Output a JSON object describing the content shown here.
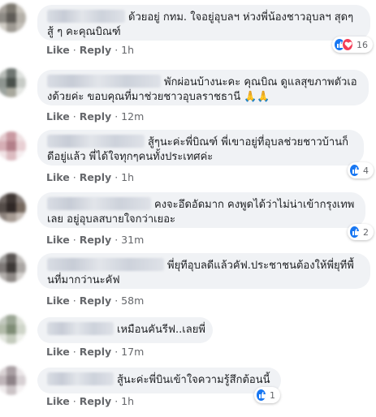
{
  "comments": [
    {
      "text": "ด้วยอยู่ กทม. ใจอยู่อุบลฯ ห่วงพี่น้องชาวอุบลฯ สุดๆ สู้ ๆ คะคุณบิณฑ์",
      "like": "Like",
      "reply": "Reply",
      "time": "1h",
      "reactions": {
        "types": [
          "like-icon",
          "love-icon"
        ],
        "count": "16"
      }
    },
    {
      "text": "พักผ่อนบ้างนะคะ คุณบิณ ดูแลสุขภาพตัวเองด้วยค่ะ ขอบคุณที่มาช่วยชาวอุบลราชธานี 🙏🙏",
      "like": "Like",
      "reply": "Reply",
      "time": "12m"
    },
    {
      "text": "สู้ๆนะค่ะพี่บิณฑ์ พี่เขาอยู่ที่อุบลช่วยชาวบ้านก็ดีอยู่แล้ว พี่ได้ใจทุกๆคนทั้งประเทศค่ะ",
      "like": "Like",
      "reply": "Reply",
      "time": "1h",
      "reactions": {
        "types": [
          "like-icon"
        ],
        "count": "4"
      }
    },
    {
      "text": "คงจะอึดอัดมาก คงพูดได้ว่าไม่น่าเข้ากรุงเทพเลย อยู่อุบลสบายใจกว่าเยอะ",
      "like": "Like",
      "reply": "Reply",
      "time": "31m",
      "reactions": {
        "types": [
          "like-icon"
        ],
        "count": "2"
      }
    },
    {
      "text": "พี่ยุทีอุบลดีแล้วคัฟ.ประชาชนต้องให้พี่ยุทีพื้นที่มากว่านะคัฟ",
      "like": "Like",
      "reply": "Reply",
      "time": "58m"
    },
    {
      "text": "เหมือนคันรีฟ..เลยพี่",
      "like": "Like",
      "reply": "Reply",
      "time": "17m"
    },
    {
      "text": "สู้นะค่ะพี่บินเข้าใจความรู้สึกต้อนนี้",
      "like": "Like",
      "reply": "Reply",
      "time": "1h",
      "reactions": {
        "types": [
          "like-icon"
        ],
        "count": "1"
      }
    }
  ],
  "colors": {
    "bubble": "#f0f2f5",
    "like_blue": "#1877f2",
    "love_red": "#f33e58",
    "meta_gray": "#65676b",
    "text": "#1c1e21"
  }
}
